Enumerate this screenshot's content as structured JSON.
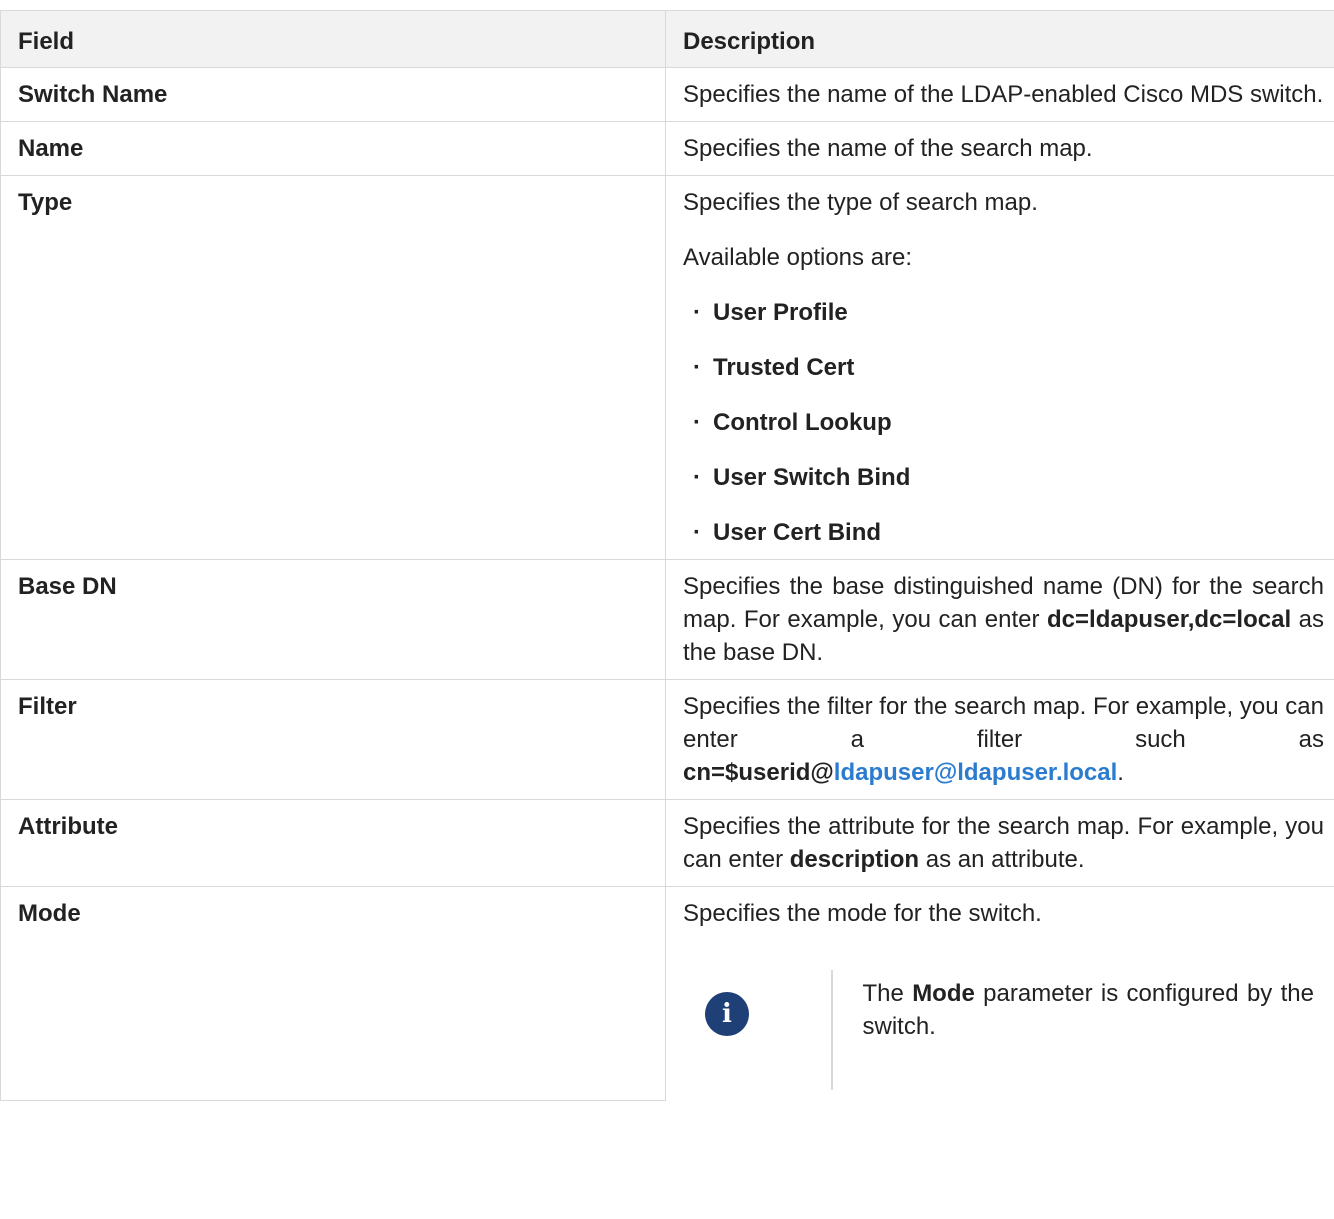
{
  "header": {
    "field": "Field",
    "description": "Description"
  },
  "rows": {
    "switch_name": {
      "field": "Switch Name",
      "desc": "Specifies the name of the LDAP-enabled Cisco MDS switch."
    },
    "name": {
      "field": "Name",
      "desc": "Specifies the name of the search map."
    },
    "type": {
      "field": "Type",
      "desc": "Specifies the type of search map.",
      "options_intro": "Available options are:",
      "options": [
        "User Profile",
        "Trusted Cert",
        "Control Lookup",
        "User Switch Bind",
        "User Cert Bind"
      ]
    },
    "base_dn": {
      "field": "Base DN",
      "desc_prefix": "Specifies the base distinguished name (DN) for the search map. For example, you can enter ",
      "example": "dc=ldapuser,dc=local",
      "desc_suffix": " as the base DN."
    },
    "filter": {
      "field": "Filter",
      "desc_prefix": "Specifies the filter for the search map. For example, you can enter a filter such as ",
      "example_bold": "cn=$userid@",
      "example_link": "ldapuser@ldapuser.local",
      "desc_suffix": "."
    },
    "attribute": {
      "field": "Attribute",
      "desc_prefix": "Specifies the attribute for the search map. For example, you can enter ",
      "example": "description",
      "desc_suffix": " as an attribute."
    },
    "mode": {
      "field": "Mode",
      "desc": "Specifies the mode for the switch.",
      "note_icon": "info-icon",
      "note_prefix": "The ",
      "note_bold": "Mode",
      "note_suffix": " parameter is configured by the switch."
    }
  },
  "colors": {
    "header_bg": "#f2f2f2",
    "border": "#d9d9d9",
    "link": "#2b7ccf",
    "note_icon_bg": "#1f3f77"
  }
}
